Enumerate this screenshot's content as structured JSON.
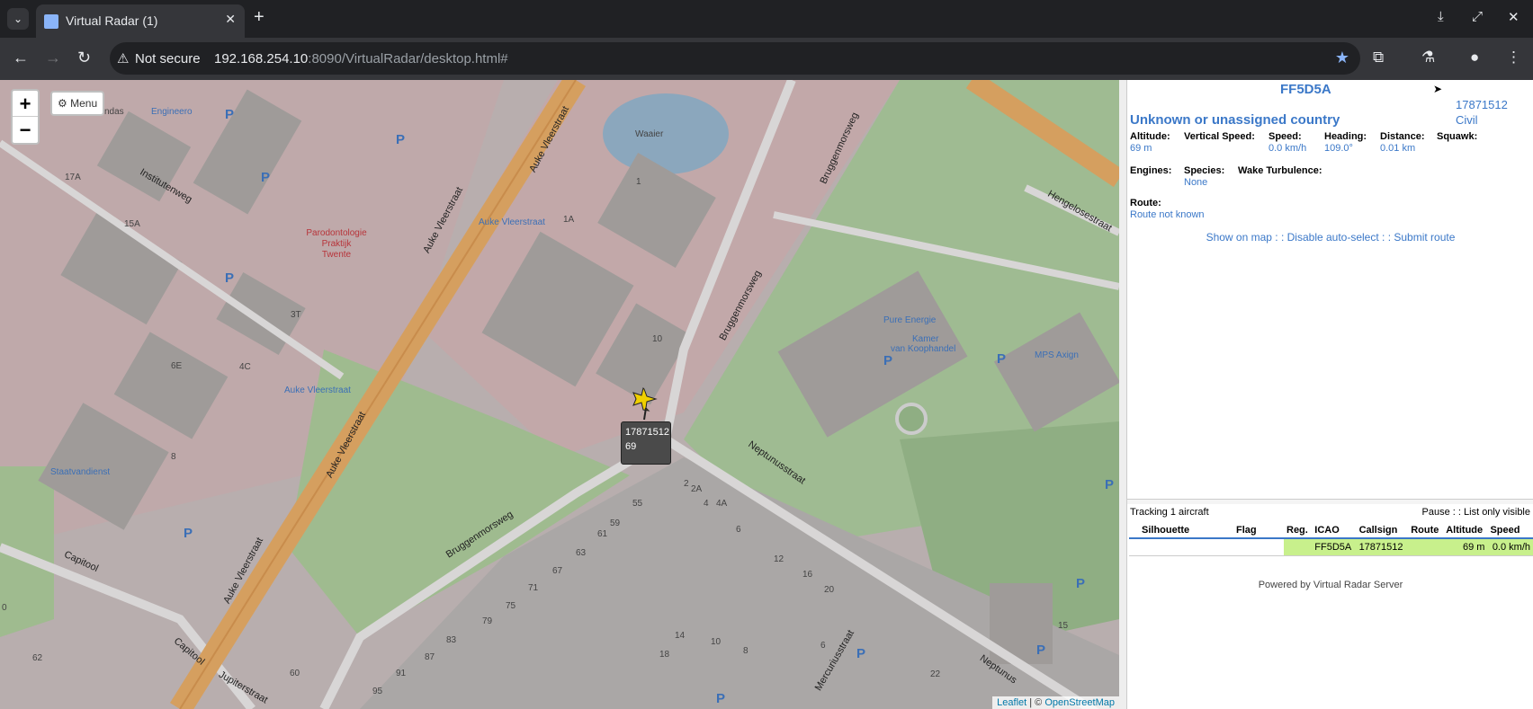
{
  "browser": {
    "tab_title": "Virtual Radar (1)",
    "tab_close": "✕",
    "new_tab": "+",
    "not_secure": "Not secure",
    "url_host": "192.168.254.10",
    "url_path": ":8090/VirtualRadar/desktop.html#"
  },
  "map": {
    "zoom_in": "+",
    "zoom_out": "−",
    "menu_label": "Menu",
    "labels": {
      "engineero": "Engineero",
      "waaier": "Waaier",
      "ndas": "ndas",
      "institutenweg": "Institutenweg",
      "parodontologie": "Parodontologie",
      "praktijk": "Praktijk",
      "twente": "Twente",
      "auke1": "Auke Vleerstraat",
      "auke2": "Auke Vleerstraat",
      "auke3": "Auke Vleerstraat",
      "auke_stop1": "Auke Vleerstraat",
      "auke_stop2": "Auke Vleerstraat",
      "auke4": "Auke Vleerstraat",
      "bruggenmorsweg1": "Bruggenmorsweg",
      "bruggenmorsweg2": "Bruggenmorsweg",
      "bruggenmorsweg3": "Bruggenmorsweg",
      "hengelosestraat": "Hengelosestraat",
      "pure_energie": "Pure Energie",
      "kamer1": "Kamer",
      "kamer2": "van Koophandel",
      "mps": "MPS Axign",
      "staatvandienst": "Staatvandienst",
      "capitool1": "Capitool",
      "capitool2": "Capitool",
      "jupiterstraat": "Jupiterstraat",
      "neptunusstraat": "Neptunusstraat",
      "neptunus2": "Neptunus",
      "mercuriusstraat": "Mercuriusstraat",
      "n15a": "15A",
      "n17a": "17A",
      "n1a": "1A",
      "n1": "1",
      "n3t": "3T",
      "n6e": "6E",
      "n4c": "4C",
      "n10": "10",
      "n8": "8",
      "n55": "55",
      "n59": "59",
      "n61": "61",
      "n63": "63",
      "n67": "67",
      "n71": "71",
      "n75": "75",
      "n79": "79",
      "n83": "83",
      "n87": "87",
      "n91": "91",
      "n95": "95",
      "n62": "62",
      "n60": "60",
      "n2": "2",
      "n2a": "2A",
      "n4": "4",
      "n4a": "4A",
      "n6": "6",
      "n12": "12",
      "n14": "14",
      "n16": "16",
      "n18": "18",
      "n20": "20",
      "n22": "22",
      "n15": "15",
      "n10b": "10",
      "n8b": "8",
      "n6b": "6",
      "n0": "0"
    },
    "parking": "P",
    "tooltip_reg": "17871512",
    "tooltip_alt": "69",
    "attribution_leaflet": "Leaflet",
    "attribution_sep": " | © ",
    "attribution_osm": "OpenStreetMap"
  },
  "detail": {
    "icao": "FF5D5A",
    "country": "Unknown or unassigned country",
    "registration": "17871512",
    "type": "Civil",
    "fields": {
      "altitude_label": "Altitude:",
      "altitude_value": "69 m",
      "vspeed_label": "Vertical Speed:",
      "speed_label": "Speed:",
      "speed_value": "0.0 km/h",
      "heading_label": "Heading:",
      "heading_value": "109.0°",
      "distance_label": "Distance:",
      "distance_value": "0.01 km",
      "squawk_label": "Squawk:",
      "engines_label": "Engines:",
      "species_label": "Species:",
      "species_value": "None",
      "wake_label": "Wake Turbulence:",
      "route_label": "Route:",
      "route_value": "Route not known"
    },
    "link_show": "Show on map",
    "link_sep1": " : : ",
    "link_disable": "Disable auto-select",
    "link_sep2": " : : ",
    "link_submit": "Submit route"
  },
  "list": {
    "tracking": "Tracking 1 aircraft",
    "options": "Pause : : List only visible",
    "headers": {
      "silhouette": "Silhouette",
      "flag": "Flag",
      "reg": "Reg.",
      "icao": "ICAO",
      "callsign": "Callsign",
      "route": "Route",
      "altitude": "Altitude",
      "speed": "Speed"
    },
    "row": {
      "icao": "FF5D5A",
      "callsign": "17871512",
      "altitude": "69 m",
      "speed": "0.0 km/h"
    },
    "powered": "Powered by Virtual Radar Server"
  },
  "colors": {
    "accent": "#3b78c8",
    "highlight": "#c8f08c",
    "tram": "#d59f5f",
    "grass": "#94b886"
  }
}
